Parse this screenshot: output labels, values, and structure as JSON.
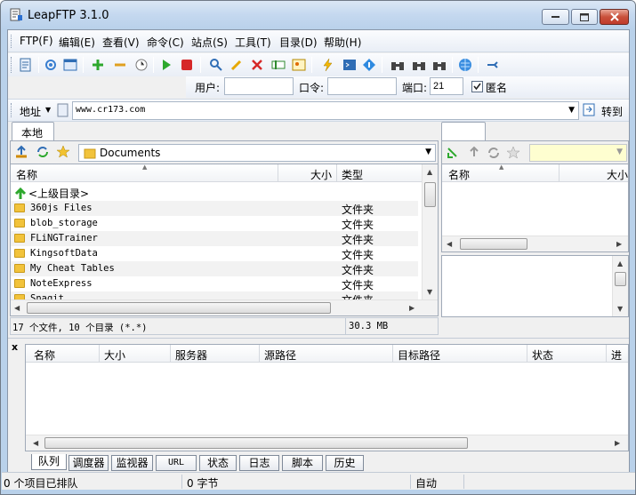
{
  "window": {
    "title": "LeapFTP 3.1.0"
  },
  "menu": [
    "FTP(F)",
    "编辑(E)",
    "查看(V)",
    "命令(C)",
    "站点(S)",
    "工具(T)",
    "目录(D)",
    "帮助(H)"
  ],
  "login": {
    "user_label": "用户:",
    "user_value": "",
    "pass_label": "口令:",
    "pass_value": "",
    "port_label": "端口:",
    "port_value": "21",
    "anon_label": "匿名",
    "anon_checked": true
  },
  "address": {
    "label": "地址",
    "value": "www.cr173.com",
    "go_label": "转到"
  },
  "local": {
    "tab": "本地",
    "path": "Documents",
    "columns": [
      "名称",
      "大小",
      "类型"
    ],
    "parent_label": "<上级目录>",
    "rows": [
      {
        "name": "360js Files",
        "type": "文件夹"
      },
      {
        "name": "blob_storage",
        "type": "文件夹"
      },
      {
        "name": "FLiNGTrainer",
        "type": "文件夹"
      },
      {
        "name": "KingsoftData",
        "type": "文件夹"
      },
      {
        "name": "My Cheat Tables",
        "type": "文件夹"
      },
      {
        "name": "NoteExpress",
        "type": "文件夹"
      },
      {
        "name": "Snagit",
        "type": "文件夹"
      }
    ],
    "status_left": "17 个文件, 10 个目录 (*.*)",
    "status_right": "30.3 MB"
  },
  "remote": {
    "columns": [
      "名称",
      "大小"
    ]
  },
  "queue": {
    "columns": [
      "名称",
      "大小",
      "服务器",
      "源路径",
      "目标路径",
      "状态",
      "进"
    ],
    "tabs": [
      "队列",
      "调度器",
      "监视器",
      "URL",
      "状态",
      "日志",
      "脚本",
      "历史"
    ],
    "close_label": "x"
  },
  "statusbar": {
    "queued": "0 个项目已排队",
    "bytes": "0 字节",
    "mode": "自动"
  }
}
